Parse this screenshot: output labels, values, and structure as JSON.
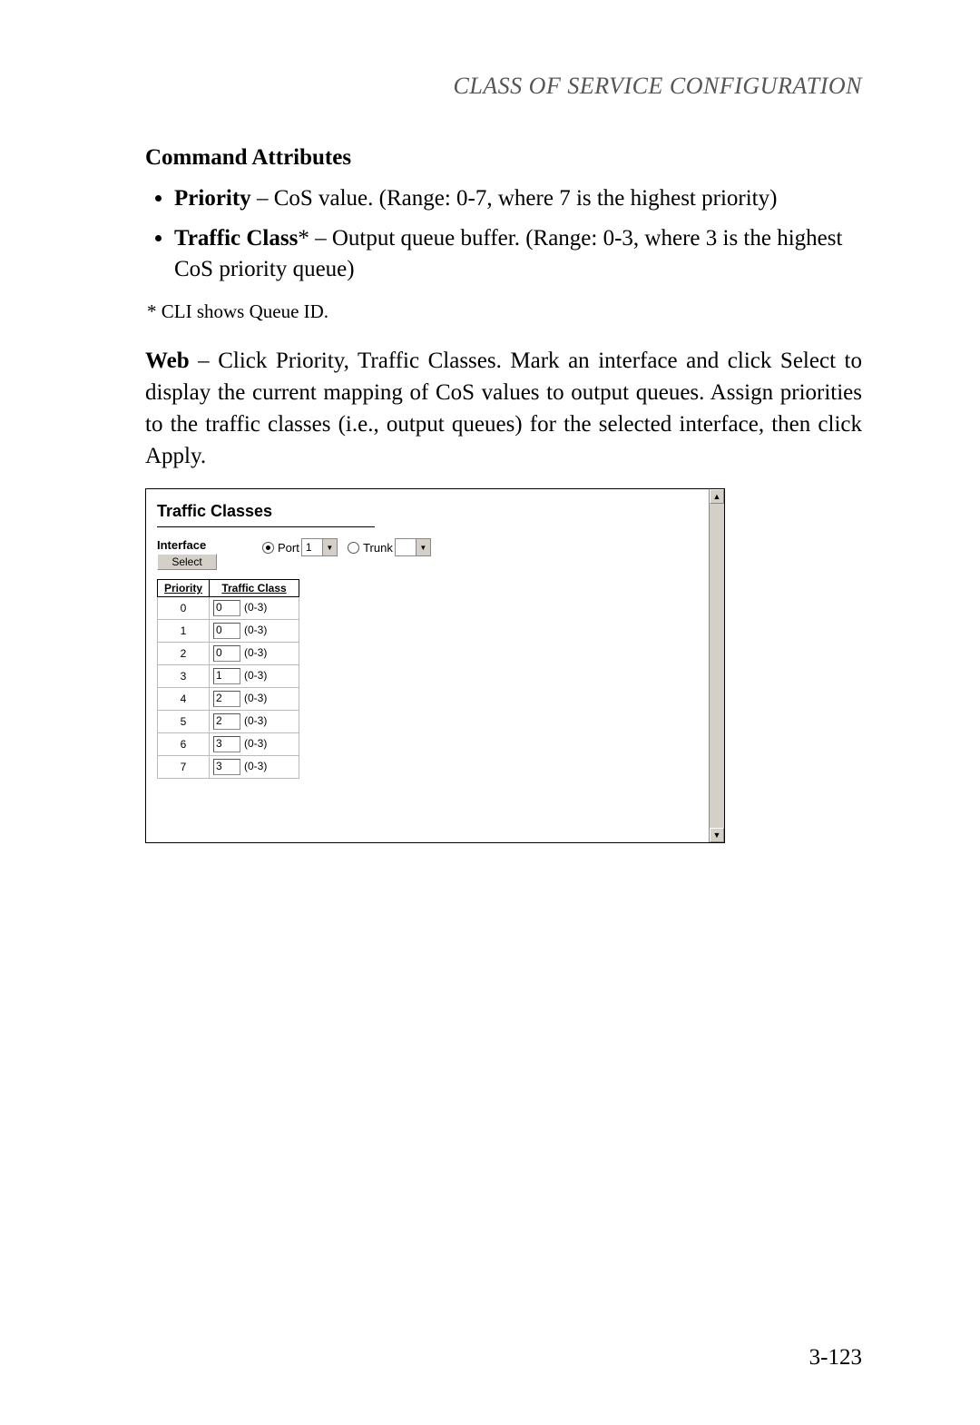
{
  "running_head": "CLASS OF SERVICE CONFIGURATION",
  "section_title": "Command Attributes",
  "bullets": [
    {
      "term": "Priority",
      "desc": " – CoS value. (Range: 0-7, where 7 is the highest priority)"
    },
    {
      "term": "Traffic Class",
      "star": "*",
      "desc": " – Output queue buffer. (Range: 0-3, where 3 is the highest CoS priority queue)"
    }
  ],
  "footnote": "*  CLI shows Queue ID.",
  "web_para_lead": "Web",
  "web_para_rest": " – Click Priority, Traffic Classes. Mark an interface and click Select to display the current mapping of CoS values to output queues. Assign priorities to the traffic classes (i.e., output queues) for the selected interface, then click Apply.",
  "ui": {
    "panel_title": "Traffic Classes",
    "interface_label": "Interface",
    "select_button": "Select",
    "port_label": "Port",
    "port_value": "1",
    "trunk_label": "Trunk",
    "trunk_value": "",
    "table": {
      "col_priority": "Priority",
      "col_traffic_class": "Traffic Class",
      "range_hint": "(0-3)",
      "rows": [
        {
          "priority": "0",
          "value": "0"
        },
        {
          "priority": "1",
          "value": "0"
        },
        {
          "priority": "2",
          "value": "0"
        },
        {
          "priority": "3",
          "value": "1"
        },
        {
          "priority": "4",
          "value": "2"
        },
        {
          "priority": "5",
          "value": "2"
        },
        {
          "priority": "6",
          "value": "3"
        },
        {
          "priority": "7",
          "value": "3"
        }
      ]
    }
  },
  "page_number": "3-123"
}
